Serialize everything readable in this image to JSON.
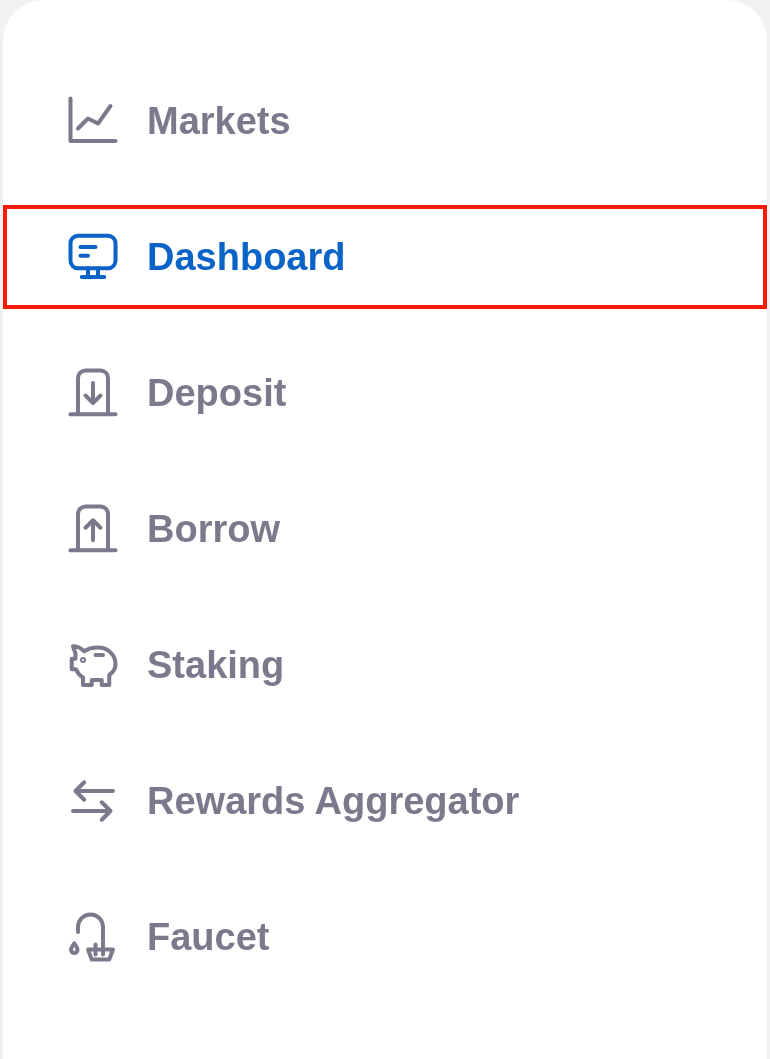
{
  "nav": {
    "items": [
      {
        "label": "Markets",
        "kind": "chart",
        "selected": false
      },
      {
        "label": "Dashboard",
        "kind": "monitor",
        "selected": true
      },
      {
        "label": "Deposit",
        "kind": "deposit",
        "selected": false
      },
      {
        "label": "Borrow",
        "kind": "borrow",
        "selected": false
      },
      {
        "label": "Staking",
        "kind": "piggy",
        "selected": false
      },
      {
        "label": "Rewards Aggregator",
        "kind": "swap",
        "selected": false
      },
      {
        "label": "Faucet",
        "kind": "faucet",
        "selected": false
      }
    ]
  }
}
